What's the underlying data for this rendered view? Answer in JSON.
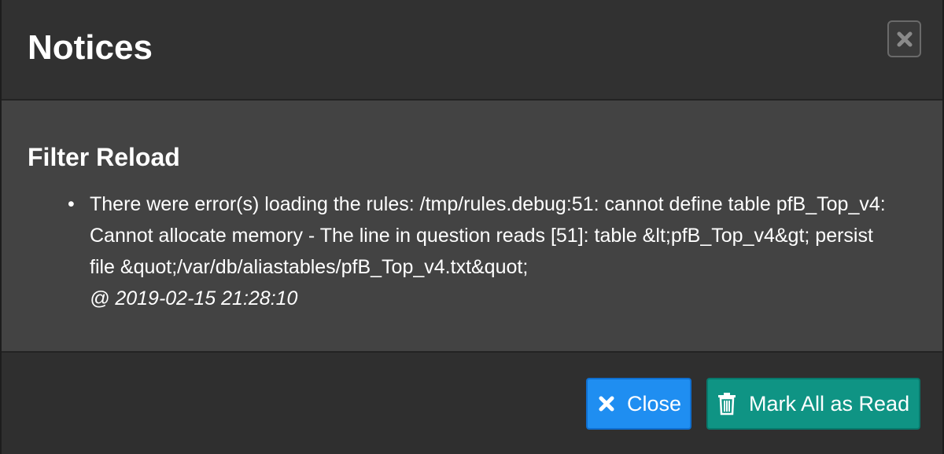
{
  "modal": {
    "title": "Notices",
    "section_title": "Filter Reload",
    "notices": [
      {
        "message": "There were error(s) loading the rules: /tmp/rules.debug:51: cannot define table pfB_Top_v4: Cannot allocate memory - The line in question reads [51]: table &lt;pfB_Top_v4&gt; persist file &quot;/var/db/aliastables/pfB_Top_v4.txt&quot;",
        "timestamp": "@ 2019-02-15 21:28:10"
      }
    ]
  },
  "buttons": {
    "close_label": "Close",
    "mark_read_label": "Mark All as Read"
  },
  "icons": {
    "header_close": "close-x-icon",
    "close_button": "close-x-icon",
    "mark_read_button": "trash-icon"
  },
  "colors": {
    "close_button": "#1f8ef1",
    "mark_read_button": "#0f9484",
    "body_background": "#434343",
    "header_background": "#313131"
  }
}
